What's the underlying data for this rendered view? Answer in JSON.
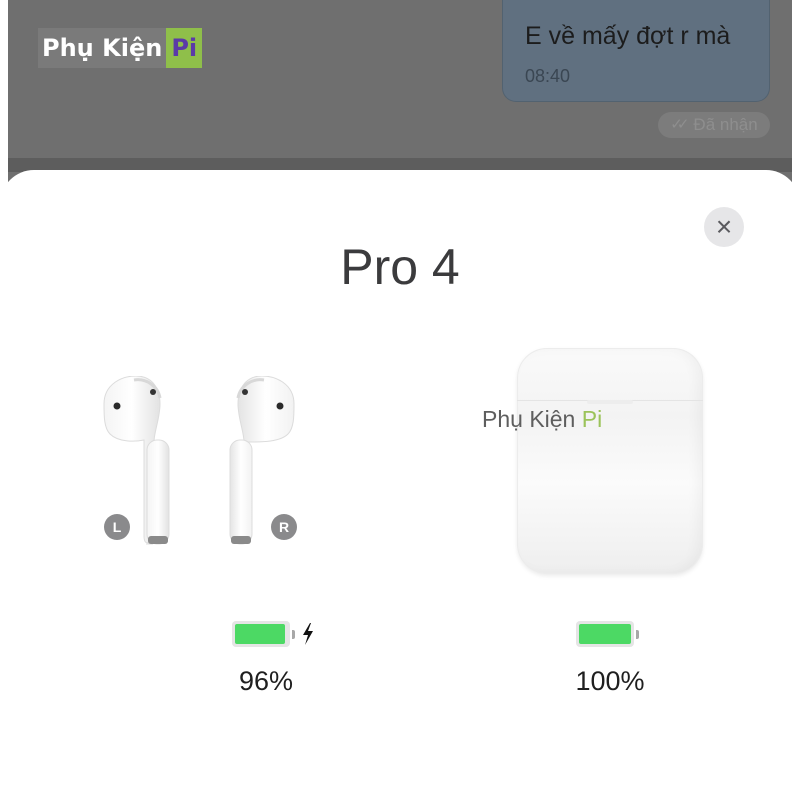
{
  "watermark_logo": {
    "main": "Phụ Kiện",
    "pi": "Pi"
  },
  "chat": {
    "message_text": "E về mấy đợt r mà",
    "message_time": "08:40",
    "status_text": "Đã nhận"
  },
  "modal": {
    "title": "Pro 4",
    "close_icon": "×",
    "earbuds": {
      "left_label": "L",
      "right_label": "R",
      "battery_percent": 96,
      "battery_text": "96%",
      "charging": true
    },
    "case": {
      "battery_percent": 100,
      "battery_text": "100%"
    },
    "watermark": {
      "main": "Phụ Kiện ",
      "pi": "Pi"
    }
  },
  "colors": {
    "battery_green": "#4cd964",
    "logo_green": "#8fbf4a",
    "logo_purple": "#5b3aa8"
  }
}
